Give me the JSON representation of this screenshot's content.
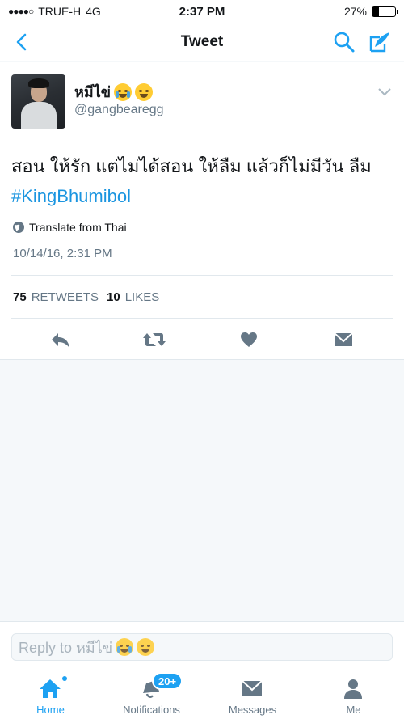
{
  "status_bar": {
    "signal_dots": "●●●●○",
    "carrier": "TRUE-H",
    "network": "4G",
    "time": "2:37 PM",
    "battery_percent": "27%",
    "battery_level": 0.27
  },
  "nav": {
    "title": "Tweet",
    "icons": [
      "back-chevron-icon",
      "search-icon",
      "compose-icon"
    ]
  },
  "tweet": {
    "user_name": "หมีไข่",
    "user_emojis": [
      "crying-emoji",
      "laughing-tears-emoji"
    ],
    "handle": "@gangbearegg",
    "text": "สอน ให้รัก แต่ไม่ได้สอน ให้ลืม แล้วก็ไม่มีวัน ลืม",
    "hashtag": "#KingBhumibol",
    "translate_label": "Translate from Thai",
    "timestamp": "10/14/16, 2:31 PM",
    "retweet_count": "75",
    "retweet_label": "RETWEETS",
    "like_count": "10",
    "like_label": "LIKES"
  },
  "reply": {
    "placeholder": "Reply to หมีไข่"
  },
  "tabs": [
    {
      "label": "Home",
      "active": true
    },
    {
      "label": "Notifications",
      "badge": "20+"
    },
    {
      "label": "Messages"
    },
    {
      "label": "Me"
    }
  ],
  "colors": {
    "accent": "#1da1f2",
    "hashtag": "#1b95e0",
    "secondary_text": "#657786",
    "icon": "#657786"
  }
}
